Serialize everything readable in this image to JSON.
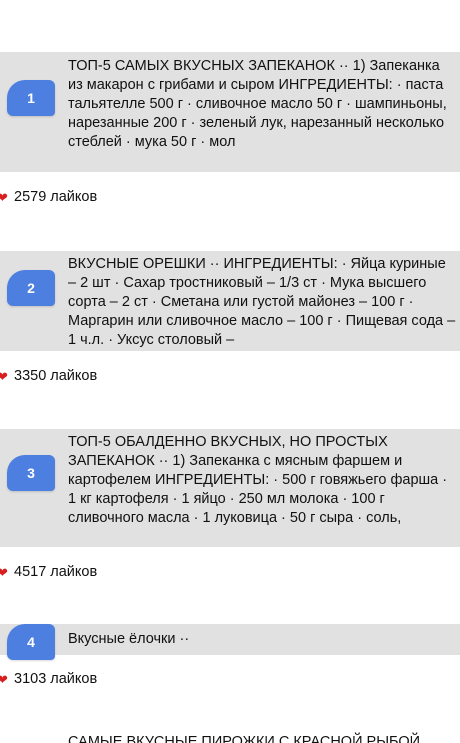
{
  "posts": [
    {
      "rank": "1",
      "text": "ТОП-5 САМЫХ ВКУСНЫХ ЗАПЕКАНОК ·· 1) Запеканка из макарон с грибами и сыром ИНГРЕДИЕНТЫ: · паста тальятелле 500 г · сливочное масло 50 г · шампиньоны, нарезанные 200 г · зеленый лук, нарезанный несколько стеблей · мука 50 г · мол",
      "likes": "2579 лайков"
    },
    {
      "rank": "2",
      "text": "ВКУСНЫЕ ОРЕШКИ ·· ИНГРЕДИЕНТЫ: · Яйца куриные – 2 шт · Сахар тростниковый – 1/3 ст · Мука высшего сорта – 2 ст · Сметана или густой майонез – 100 г · Маргарин или сливочное масло – 100 г · Пищевая сода – 1 ч.л. · Уксус столовый –",
      "likes": "3350 лайков"
    },
    {
      "rank": "3",
      "text": "ТОП-5 ОБАЛДЕННО ВКУСНЫХ, НО ПРОСТЫХ ЗАПЕКАНОК ·· 1) Запеканка с мясным фаршем и картофелем ИНГРЕДИЕНТЫ: · 500 г говяжьего фарша · 1 кг картофеля · 1 яйцо · 250 мл молока · 100 г сливочного масла · 1 луковица · 50 г сыра · соль,",
      "likes": "4517 лайков"
    },
    {
      "rank": "4",
      "text": "Вкусные ёлочки ··",
      "likes": "3103 лайков"
    }
  ],
  "next_post_title": "САМЫЕ ВКУСНЫЕ ПИРОЖКИ С КРАСНОЙ РЫБОЙ",
  "icons": {
    "like": "heart-icon"
  },
  "colors": {
    "badge": "#4c7fe0",
    "card_bg": "#e1e1e1",
    "heart": "#d81e1e"
  }
}
